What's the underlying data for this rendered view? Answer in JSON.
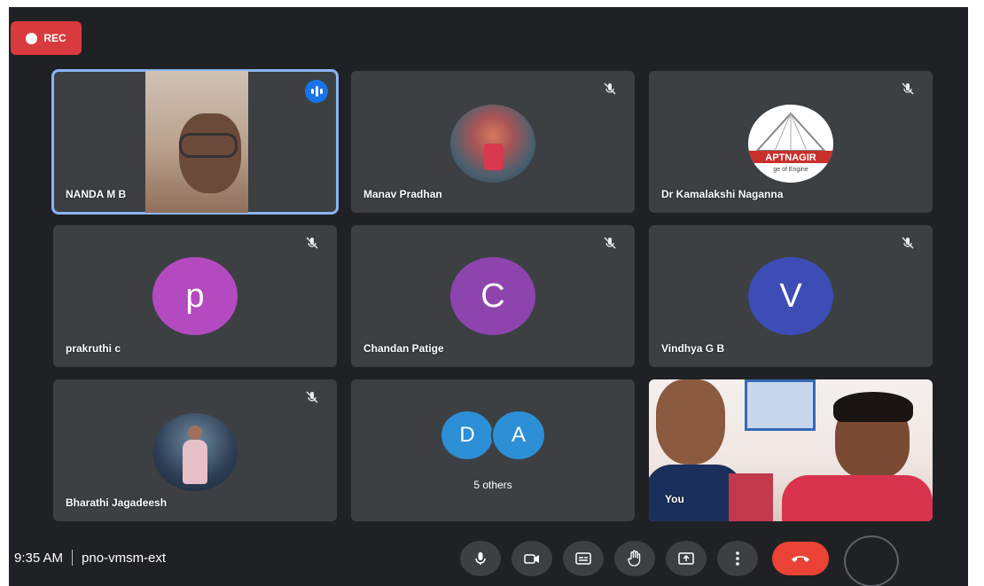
{
  "recording": {
    "label": "REC",
    "color": "#d93a3d"
  },
  "participants": [
    {
      "name": "NANDA M B",
      "speaking": true,
      "avatar": "video-feed"
    },
    {
      "name": "Manav Pradhan",
      "muted": true,
      "avatar": "profile-photo"
    },
    {
      "name": "Dr Kamalakshi Naganna",
      "muted": true,
      "avatar": "college-logo",
      "logo_text": "APTNAGIR",
      "logo_subtext": "ge of Engine"
    },
    {
      "name": "prakruthi c",
      "muted": true,
      "initial": "p",
      "avatar_color": "#b44ac0"
    },
    {
      "name": "Chandan Patige",
      "muted": true,
      "initial": "C",
      "avatar_color": "#8e44ad"
    },
    {
      "name": "Vindhya G B",
      "muted": true,
      "initial": "V",
      "avatar_color": "#3c4db6"
    },
    {
      "name": "Bharathi Jagadeesh",
      "muted": true,
      "avatar": "profile-photo"
    }
  ],
  "others": {
    "initials": [
      "D",
      "A"
    ],
    "label": "5 others",
    "avatar_color": "#2d8fd5"
  },
  "self_view": {
    "name": "You"
  },
  "meeting": {
    "time": "9:35 AM",
    "code": "pno-vmsm-ext"
  },
  "controls": [
    {
      "name": "microphone",
      "icon": "mic-icon"
    },
    {
      "name": "camera",
      "icon": "camera-off-icon"
    },
    {
      "name": "captions",
      "icon": "captions-icon"
    },
    {
      "name": "raise-hand",
      "icon": "hand-icon"
    },
    {
      "name": "present",
      "icon": "present-screen-icon"
    },
    {
      "name": "more-options",
      "icon": "more-vert-icon"
    }
  ],
  "end_call": {
    "icon": "phone-hangup-icon",
    "color": "#ea4335"
  }
}
